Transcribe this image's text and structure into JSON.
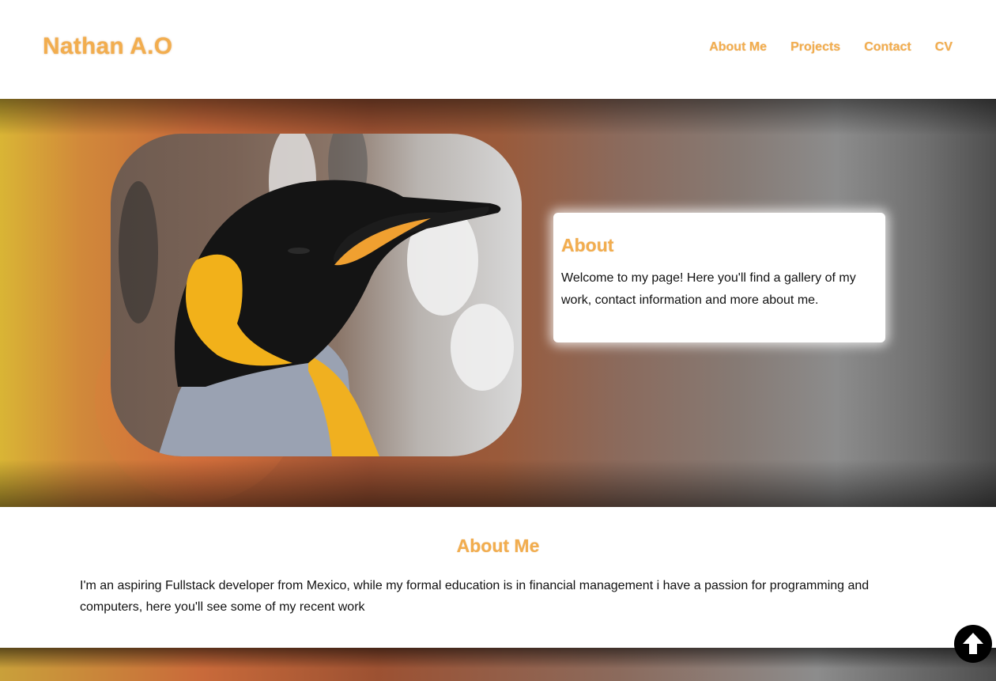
{
  "header": {
    "brand": "Nathan A.O",
    "nav": [
      {
        "label": "About Me"
      },
      {
        "label": "Projects"
      },
      {
        "label": "Contact"
      },
      {
        "label": "CV"
      }
    ]
  },
  "hero": {
    "image": "king-penguin-photo",
    "card": {
      "title": "About",
      "text": "Welcome to my page! Here you'll find a gallery of my work, contact information and more about me."
    }
  },
  "about_me": {
    "title": "About Me",
    "text": "I'm an aspiring Fullstack developer from Mexico, while my formal education is in financial management i have a passion for programming and computers, here you'll see some of my recent work"
  },
  "scroll_top": {
    "icon": "arrow-up-icon"
  },
  "colors": {
    "accent": "#f2ad4e",
    "text": "#111111",
    "background": "#ffffff"
  }
}
